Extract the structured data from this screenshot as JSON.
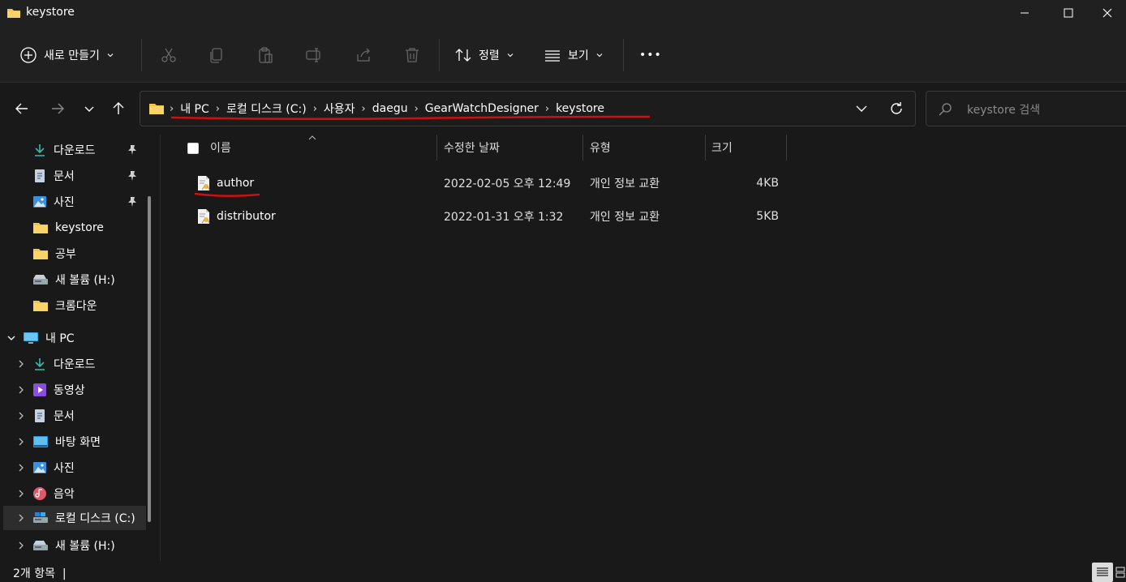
{
  "window": {
    "title": "keystore"
  },
  "toolbar": {
    "new_label": "새로 만들기",
    "sort_label": "정렬",
    "view_label": "보기",
    "more_label": "•••"
  },
  "address": {
    "crumbs": [
      "내 PC",
      "로컬 디스크 (C:)",
      "사용자",
      "daegu",
      "GearWatchDesigner",
      "keystore"
    ],
    "separator": "›",
    "annotation_color": "#d01010"
  },
  "search": {
    "placeholder": "keystore 검색"
  },
  "sidebar": {
    "quick_access": [
      {
        "label": "다운로드",
        "icon": "download-icon",
        "pinned": true
      },
      {
        "label": "문서",
        "icon": "document-icon",
        "pinned": true
      },
      {
        "label": "사진",
        "icon": "pictures-icon",
        "pinned": true
      },
      {
        "label": "keystore",
        "icon": "folder-icon",
        "pinned": false
      },
      {
        "label": "공부",
        "icon": "folder-icon",
        "pinned": false
      },
      {
        "label": "새 볼륨 (H:)",
        "icon": "drive-icon",
        "pinned": false
      },
      {
        "label": "크롬다운",
        "icon": "folder-icon",
        "pinned": false
      }
    ],
    "this_pc": {
      "label": "내 PC",
      "icon": "computer-icon"
    },
    "pc_children": [
      {
        "label": "다운로드",
        "icon": "download-icon"
      },
      {
        "label": "동영상",
        "icon": "videos-icon"
      },
      {
        "label": "문서",
        "icon": "document-icon"
      },
      {
        "label": "바탕 화면",
        "icon": "desktop-icon"
      },
      {
        "label": "사진",
        "icon": "pictures-icon"
      },
      {
        "label": "음악",
        "icon": "music-icon"
      },
      {
        "label": "로컬 디스크 (C:)",
        "icon": "drive-icon",
        "selected": true
      },
      {
        "label": "새 볼륨 (H:)",
        "icon": "drive-icon"
      }
    ]
  },
  "columns": {
    "name": "이름",
    "modified": "수정한 날짜",
    "type": "유형",
    "size": "크기"
  },
  "files": [
    {
      "name": "author",
      "modified": "2022-02-05 오후 12:49",
      "type": "개인 정보 교환",
      "size": "4KB",
      "annotated": true
    },
    {
      "name": "distributor",
      "modified": "2022-01-31 오후 1:32",
      "type": "개인 정보 교환",
      "size": "5KB",
      "annotated": false
    }
  ],
  "status": {
    "item_count": "2개 항목",
    "separator": "|"
  }
}
